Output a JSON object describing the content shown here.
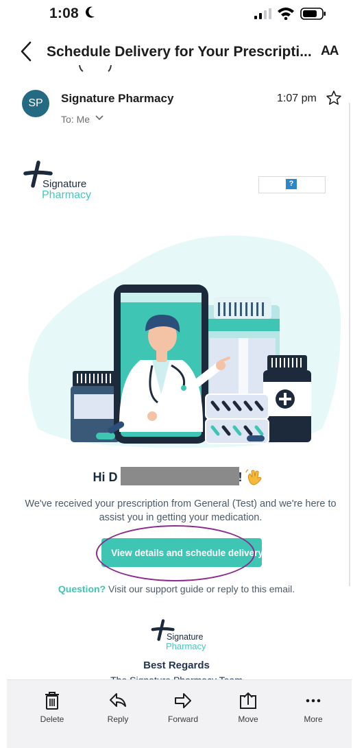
{
  "status_bar": {
    "time": "1:08"
  },
  "header": {
    "subject": "Schedule Delivery for Your Prescripti...",
    "text_size_label": "AA"
  },
  "sender": {
    "initials": "SP",
    "name": "Signature Pharmacy",
    "to": "To: Me",
    "time": "1:07 pm"
  },
  "email": {
    "logo": {
      "line1": "Signature",
      "line2": "Pharmacy"
    },
    "broken_image_glyph": "?",
    "greeting": "Hi D",
    "greeting_end": "!",
    "message": "We've received your prescription from General (Test) and we're here to assist you in getting your medication.",
    "cta_label": "View details and schedule delivery",
    "question_link": "Question?",
    "question_text": " Visit our support guide or reply to this email.",
    "footer_logo": {
      "line1": "Signature",
      "line2": "Pharmacy"
    },
    "regards": "Best Regards",
    "team": "The Signature Pharmacy Team"
  },
  "toolbar": {
    "items": [
      {
        "label": "Delete",
        "icon": "trash-icon"
      },
      {
        "label": "Reply",
        "icon": "reply-icon"
      },
      {
        "label": "Forward",
        "icon": "forward-icon"
      },
      {
        "label": "Move",
        "icon": "move-icon"
      },
      {
        "label": "More",
        "icon": "more-icon"
      }
    ]
  },
  "colors": {
    "brand_teal": "#3ec5b3",
    "brand_navy": "#1d2a3c",
    "avatar": "#246a82",
    "annotation_ellipse": "#8b2b8c"
  }
}
